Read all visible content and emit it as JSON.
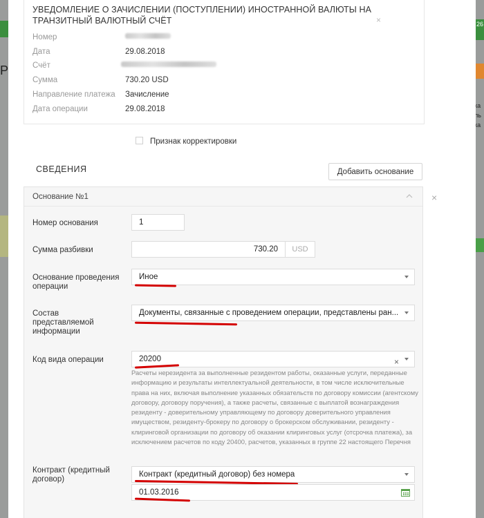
{
  "notice": {
    "title": "УВЕДОМЛЕНИЕ О ЗАЧИСЛЕНИИ (ПОСТУПЛЕНИИ) ИНОСТРАННОЙ ВАЛЮТЫ НА ТРАНЗИТНЫЙ ВАЛЮТНЫЙ СЧЁТ",
    "close": "×",
    "fields": [
      {
        "label": "Номер",
        "value": ""
      },
      {
        "label": "Дата",
        "value": "29.08.2018"
      },
      {
        "label": "Счёт",
        "value": ""
      },
      {
        "label": "Сумма",
        "value": "730.20 USD"
      },
      {
        "label": "Направление платежа",
        "value": "Зачисление"
      },
      {
        "label": "Дата операции",
        "value": "29.08.2018"
      }
    ]
  },
  "correction": {
    "label": "Признак корректировки",
    "checked": false
  },
  "section": {
    "title": "СВЕДЕНИЯ",
    "add_button": "Добавить основание"
  },
  "basis": {
    "header": "Основание №1",
    "remove": "×",
    "number_label": "Номер основания",
    "number_value": "1",
    "amount_label": "Сумма разбивки",
    "amount_value": "730.20",
    "amount_unit": "USD",
    "reason_label_1": "Основание проведения",
    "reason_label_2": "операции",
    "reason_value": "Иное",
    "info_label_1": "Состав",
    "info_label_2": "представляемой",
    "info_label_3": "информации",
    "info_value": "Документы, связанные с проведением операции, представлены ран...",
    "opcode_label": "Код вида операции",
    "opcode_value": "20200",
    "opcode_clear": "×",
    "opcode_description": "Расчеты нерезидента за выполненные резидентом работы, оказанные услуги, переданные информацию и результаты интеллектуальной деятельности, в том числе исключительные права на них, включая выполнение указанных обязательств по договору комиссии (агентскому договору, договору поручения), а также расчеты, связанные с выплатой вознаграждения резиденту - доверительному управляющему по договору доверительного управления имуществом, резиденту-брокеру по договору о брокерском обслуживании, резиденту - клиринговой организации по договору об оказании клиринговых услуг (отсрочка платежа), за исключением расчетов по коду 20400, расчетов, указанных в группе 22 настоящего Перечня",
    "contract_label_1": "Контракт (кредитный",
    "contract_label_2": "договор)",
    "contract_value": "Контракт (кредитный договор) без номера",
    "contract_date": "01.03.2016"
  },
  "background": {
    "right_badge": "26",
    "right_text_1": "ка",
    "right_text_2": "ль",
    "right_text_3": "ка"
  },
  "colors": {
    "annotation": "#d40000",
    "accent_green": "#3b8e3e",
    "calendar_icon": "#5aa24d"
  }
}
